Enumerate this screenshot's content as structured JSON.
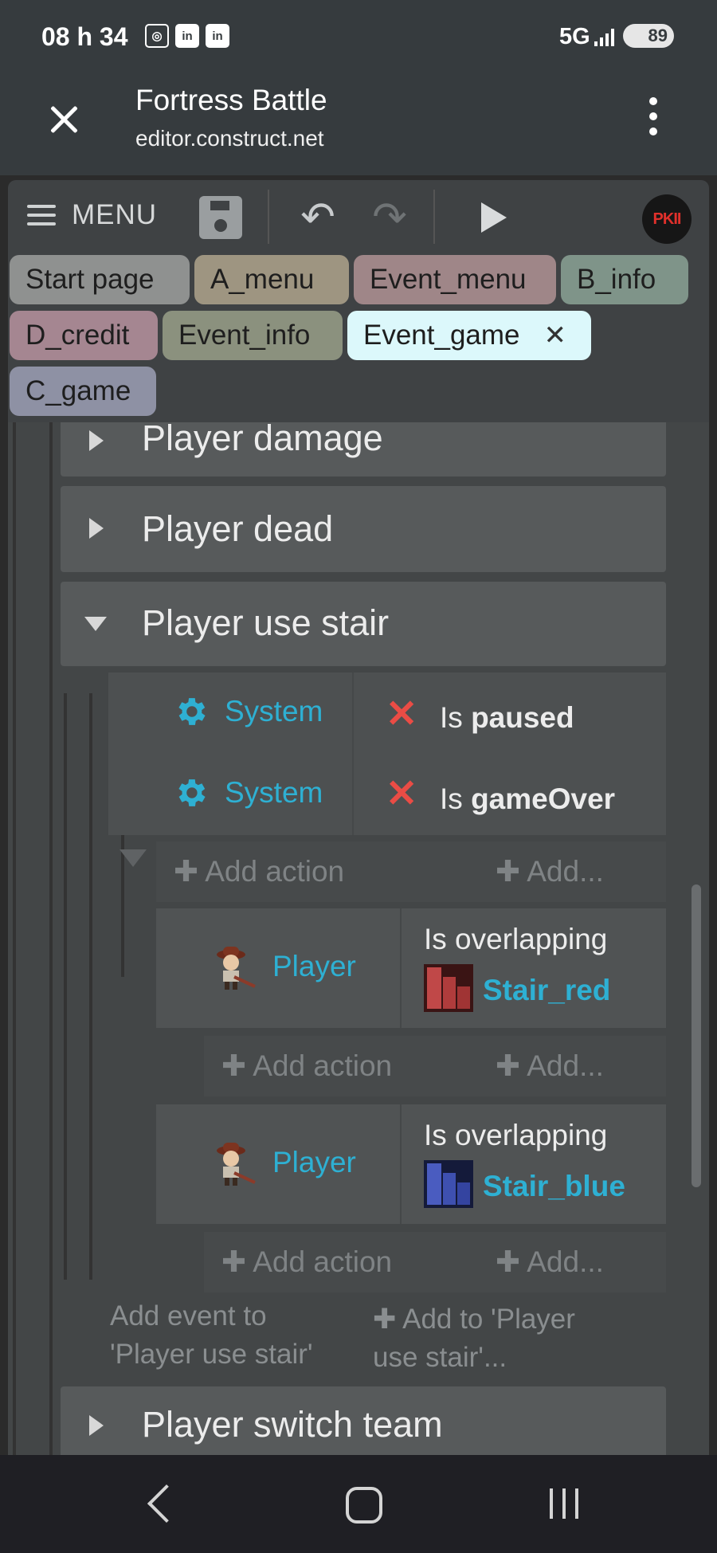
{
  "status_bar": {
    "time": "08 h 34",
    "icons": [
      "screen-capture-icon",
      "linkedin-icon",
      "linkedin-icon"
    ],
    "network": "5G",
    "battery": "89"
  },
  "browser": {
    "title": "Fortress Battle",
    "url": "editor.construct.net"
  },
  "toolbar": {
    "menu_label": "MENU",
    "avatar_text": "PKII"
  },
  "tabs": [
    {
      "label": "Start page",
      "color": "#8f9190"
    },
    {
      "label": "A_menu",
      "color": "#9e9581"
    },
    {
      "label": "Event_menu",
      "color": "#9f8688"
    },
    {
      "label": "B_info",
      "color": "#7f9489"
    },
    {
      "label": "D_credit",
      "color": "#a58691"
    },
    {
      "label": "Event_info",
      "color": "#8b917e"
    },
    {
      "label": "Event_game",
      "color": "#dcf8fb",
      "active": true
    },
    {
      "label": "C_game",
      "color": "#8e91a4"
    }
  ],
  "groups": {
    "player_damage": "Player damage",
    "player_dead": "Player dead",
    "player_use_stair": "Player use stair",
    "player_switch_team": "Player switch team"
  },
  "event1": {
    "conditions": [
      {
        "object": "System",
        "text_prefix": "Is ",
        "text_bold": "paused"
      },
      {
        "object": "System",
        "text_prefix": "Is ",
        "text_bold": "gameOver"
      }
    ],
    "add_action": "Add action",
    "add_more": "Add..."
  },
  "sub_events": [
    {
      "object": "Player",
      "condition": "Is overlapping",
      "target": "Stair_red",
      "target_color": "#b23a3a",
      "add_action": "Add action",
      "add_more": "Add..."
    },
    {
      "object": "Player",
      "condition": "Is overlapping",
      "target": "Stair_blue",
      "target_color": "#3a4fa8",
      "add_action": "Add action",
      "add_more": "Add..."
    }
  ],
  "add_event": {
    "line1": "Add event to",
    "line2": "'Player use stair'",
    "add_to_line1": "Add to 'Player",
    "add_to_line2": "use stair'..."
  },
  "accent_color": "#2eb0d3"
}
